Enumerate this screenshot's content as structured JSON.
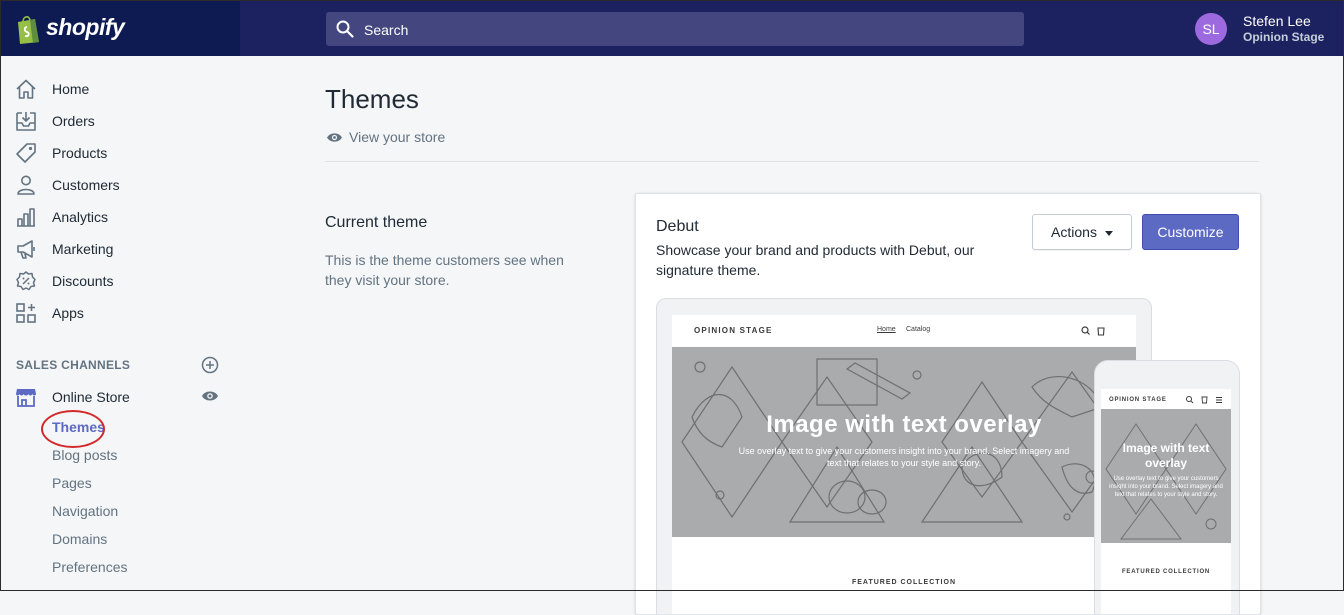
{
  "brand": {
    "name": "shopify"
  },
  "search": {
    "placeholder": "Search"
  },
  "user": {
    "initials": "SL",
    "name": "Stefen Lee",
    "store": "Opinion Stage"
  },
  "sidebar": {
    "items": [
      {
        "label": "Home",
        "icon": "home-icon"
      },
      {
        "label": "Orders",
        "icon": "orders-icon"
      },
      {
        "label": "Products",
        "icon": "tag-icon"
      },
      {
        "label": "Customers",
        "icon": "person-icon"
      },
      {
        "label": "Analytics",
        "icon": "bar-chart-icon"
      },
      {
        "label": "Marketing",
        "icon": "megaphone-icon"
      },
      {
        "label": "Discounts",
        "icon": "discount-icon"
      },
      {
        "label": "Apps",
        "icon": "apps-icon"
      }
    ],
    "sales_channels_title": "SALES CHANNELS",
    "online_store": "Online Store",
    "sub_items": [
      "Themes",
      "Blog posts",
      "Pages",
      "Navigation",
      "Domains",
      "Preferences"
    ]
  },
  "main": {
    "title": "Themes",
    "view_store": "View your store",
    "current_theme_title": "Current theme",
    "current_theme_desc": "This is the theme customers see when they visit your store."
  },
  "theme_card": {
    "name": "Debut",
    "description": "Showcase your brand and products with Debut, our signature theme.",
    "actions_label": "Actions",
    "customize_label": "Customize"
  },
  "preview": {
    "store_name": "OPINION STAGE",
    "nav": [
      "Home",
      "Catalog"
    ],
    "hero_title": "Image with text overlay",
    "hero_sub": "Use overlay text to give your customers insight into your brand. Select imagery and text that relates to your style and story.",
    "featured": "FEATURED COLLECTION"
  },
  "colors": {
    "topbar": "#1c2260",
    "logo_bg": "#0e1b53",
    "accent": "#5c6ac4",
    "avatar": "#9c6ade",
    "highlight_circle": "#d22a2a"
  }
}
